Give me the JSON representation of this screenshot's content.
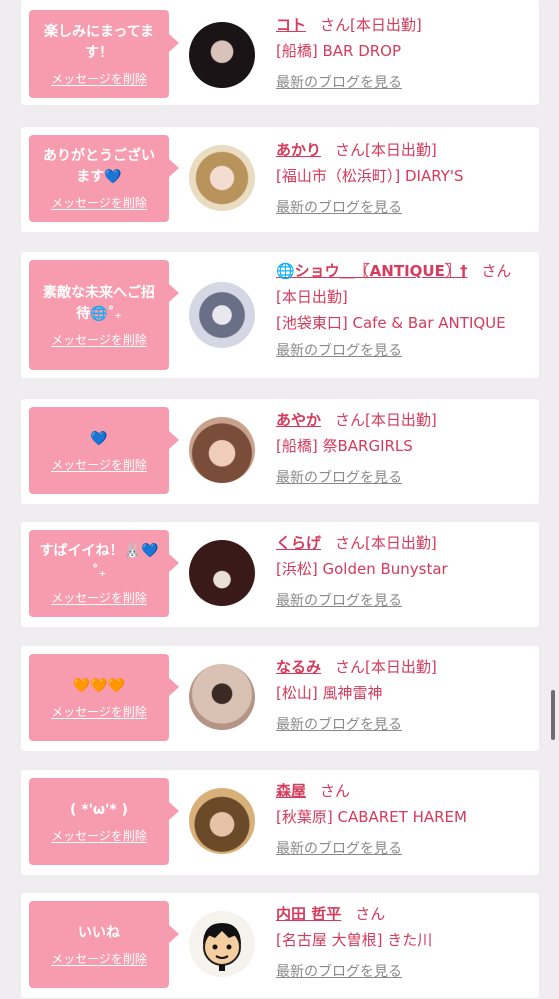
{
  "delete_label": "メッセージを削除",
  "blog_label": "最新のブログを見る",
  "honorific": "さん",
  "entries": [
    {
      "message": "楽しみにまってます！",
      "name": "コト",
      "status": "[本日出勤]",
      "shop": "[船橋] BAR DROP",
      "avatar_color": "#2a2024"
    },
    {
      "message": "ありがとうございます💙",
      "name": "あかり",
      "status": "[本日出勤]",
      "shop": "[福山市（松浜町）] DIARY'S",
      "avatar_color": "#d9c6a8"
    },
    {
      "message": "素敵な未来へご招待🌐˚₊",
      "name": "🌐ショウ＿〖ANTIQUE〗†",
      "status": "[本日出勤]",
      "shop": "[池袋東口] Cafe & Bar ANTIQUE",
      "avatar_color": "#cfd2dc"
    },
    {
      "message": "💙",
      "name": "あやか",
      "status": "[本日出勤]",
      "shop": "[船橋] 祭BARGIRLS",
      "avatar_color": "#c79a86"
    },
    {
      "message": "すばイイね！🐰💙˚₊",
      "name": "くらげ",
      "status": "[本日出勤]",
      "shop": "[浜松] Golden Bunystar",
      "avatar_color": "#5a2b28"
    },
    {
      "message": "🧡🧡🧡",
      "name": "なるみ",
      "status": "[本日出勤]",
      "shop": "[松山] 風神雷神",
      "avatar_color": "#c9b7ad"
    },
    {
      "message": "( *'ω'* )",
      "name": "森屋",
      "status": "",
      "shop": "[秋葉原] CABARET HAREM",
      "avatar_color": "#c9a070"
    },
    {
      "message": "いいね",
      "name": "内田 哲平",
      "status": "",
      "shop": "[名古屋 大曽根] きた川",
      "avatar_color": "#f6f3ee"
    }
  ]
}
